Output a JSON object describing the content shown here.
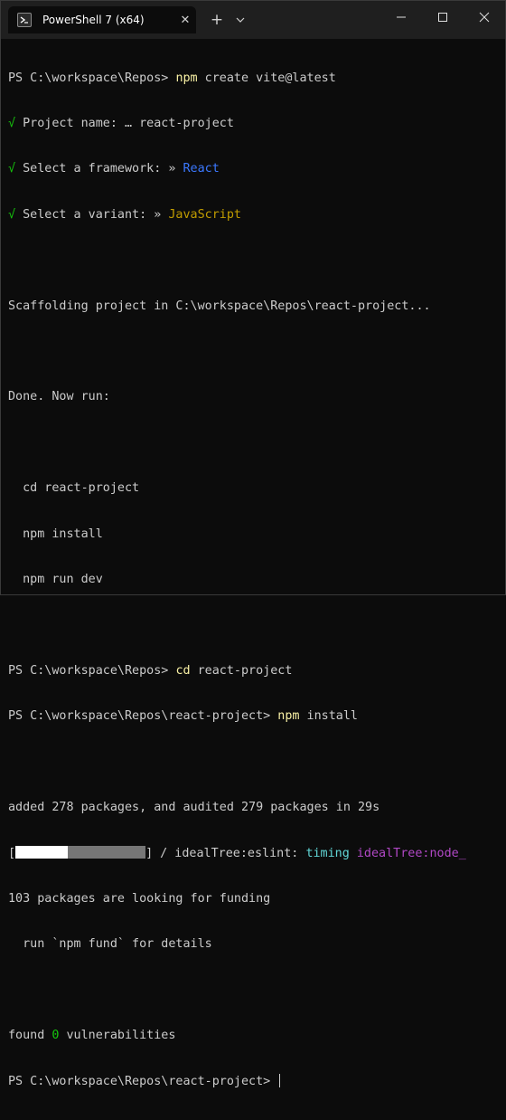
{
  "window": {
    "tab_title": "PowerShell 7 (x64)",
    "tab_close_glyph": "✕",
    "new_tab_glyph": "+",
    "dropdown_glyph": "⌄"
  },
  "terminal": {
    "l1_prompt": "PS C:\\workspace\\Repos> ",
    "l1_cmd": "npm",
    "l1_args": " create vite@latest",
    "check": "√",
    "l2_label": " Project name: … react-project",
    "l3_label": " Select a framework: ",
    "l3_arrow": "»",
    "l3_value": " React",
    "l4_label": " Select a variant: ",
    "l4_arrow": "»",
    "l4_value": " JavaScript",
    "l6": "Scaffolding project in C:\\workspace\\Repos\\react-project...",
    "l8": "Done. Now run:",
    "l10": "  cd react-project",
    "l11": "  npm install",
    "l12": "  npm run dev",
    "l14_prompt": "PS C:\\workspace\\Repos> ",
    "l14_cmd": "cd",
    "l14_args": " react-project",
    "l15_prompt": "PS C:\\workspace\\Repos\\react-project> ",
    "l15_cmd": "npm",
    "l15_args": " install",
    "l17": "added 278 packages, and audited 279 packages in 29s",
    "l18_open": "[",
    "l18_close": "] / idealTree:eslint: ",
    "l18_timing": "timing",
    "l18_tail": " idealTree:node_",
    "l18_progress": 0.4,
    "l19": "103 packages are looking for funding",
    "l20": "  run `npm fund` for details",
    "l22_a": "found ",
    "l22_zero": "0",
    "l22_b": " vulnerabilities",
    "l23_prompt": "PS C:\\workspace\\Repos\\react-project> "
  },
  "colors": {
    "background": "#0c0c0c",
    "titlebar": "#1f1f1f",
    "command_yellow": "#f9f1a5",
    "check_green": "#16c60c",
    "react_blue": "#3b78ff",
    "javascript_orange": "#c19c00",
    "timing_cyan": "#61d6d6",
    "npm_magenta": "#b148c6"
  }
}
